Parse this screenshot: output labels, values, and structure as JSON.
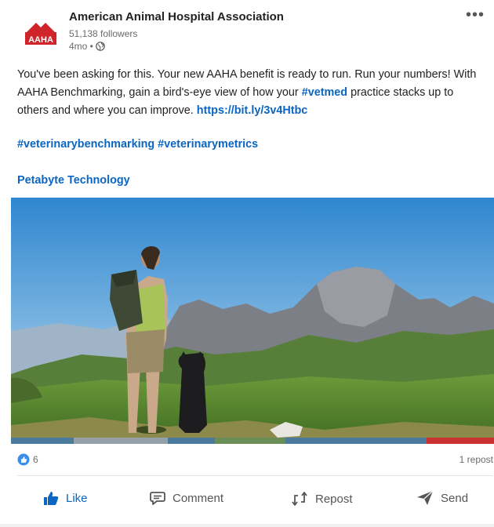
{
  "post": {
    "author": "American Animal Hospital Association",
    "logo_text": "AAHA",
    "followers": "51,138 followers",
    "time": "4mo •",
    "body_part1": "You've been asking for this. Your new AAHA benefit is ready to run. Run your numbers! With AAHA Benchmarking, gain a bird's-eye view of how your ",
    "hashtag_inline": "#vetmed",
    "body_part2": " practice stacks up to others and where you can improve. ",
    "url": "https://bit.ly/3v4Htbc",
    "hashtags": "#veterinarybenchmarking #veterinarymetrics",
    "mention": "Petabyte Technology"
  },
  "stats": {
    "reactions": "6",
    "reposts": "1 repost"
  },
  "actions": {
    "like": "Like",
    "comment": "Comment",
    "repost": "Repost",
    "send": "Send"
  },
  "colors": {
    "link": "#0a66c2",
    "brand_red": "#d0242b"
  },
  "icons": {
    "menu": "more-options-icon",
    "visibility": "globe-icon",
    "like": "thumbs-up-icon",
    "comment": "comment-icon",
    "repost": "repost-icon",
    "send": "send-icon"
  }
}
